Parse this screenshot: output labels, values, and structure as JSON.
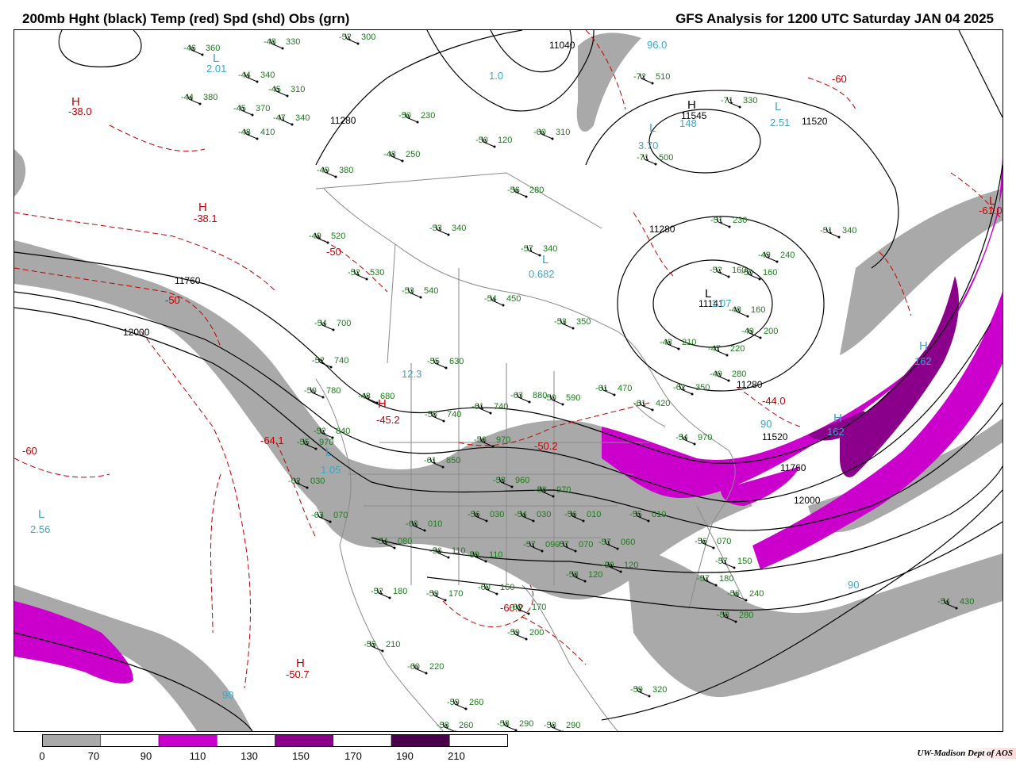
{
  "header": {
    "left_title": "200mb Hght (black) Temp (red) Spd (shd) Obs (grn)",
    "right_title": "GFS Analysis for 1200 UTC Saturday  JAN 04 2025"
  },
  "colors": {
    "height_contour": "#000000",
    "temperature_contour": "#c00000",
    "observations": "#1a7a1a",
    "speed_labels": "#3aa6c8",
    "map_lines": "#8a8a8a",
    "shade_70_90": "#a9a9a9",
    "shade_110_130": "#cc00cc",
    "shade_150_170": "#8b008b",
    "shade_190_210": "#4b004b"
  },
  "map": {
    "height_labels": [
      "11760",
      "12000",
      "11280",
      "11520",
      "11280",
      "11141",
      "11545",
      "11520",
      "11760",
      "12000",
      "11280",
      "11040"
    ],
    "pressure_centers": {
      "highs": [
        "H",
        "H",
        "H",
        "H",
        "H",
        "H",
        "H"
      ],
      "lows": [
        "L",
        "L",
        "L",
        "L",
        "L",
        "L",
        "L",
        "L"
      ]
    },
    "temperature_values": [
      "-38.0",
      "-38.1",
      "-45.2",
      "-64.1",
      "-60",
      "-50.7",
      "-60.2",
      "-50.2",
      "-44.0",
      "-61.0",
      "-60",
      "-50",
      "-50"
    ],
    "speed_values": [
      "2.01",
      "2.56",
      "96.0",
      "1.0",
      "3.70",
      "0.682",
      "12.3",
      "1.05",
      "1.07",
      "2.51",
      "90",
      "162",
      "162",
      "90",
      "90",
      "148"
    ],
    "observations": [
      "-46 360",
      "-48 330",
      "-52 300",
      "-44 340",
      "-45 310",
      "-44 380",
      "-45 370",
      "-47 340",
      "-48 410",
      "-49 380",
      "-50 230",
      "-48 250",
      "-50 120",
      "-53 340",
      "-56 280",
      "-49 520",
      "-52 530",
      "-53 540",
      "-57 340",
      "-54 450",
      "-53 350",
      "-55 630",
      "-48 680",
      "-58 740",
      "-61 740",
      "-61 850",
      "-63 880",
      "-50 590",
      "-61 470",
      "-61 420",
      "-62 350",
      "-54 700",
      "-52 740",
      "-50 780",
      "-52 840",
      "-55 970",
      "-62 030",
      "-63 070",
      "-54 080",
      "-56 110",
      "-59 110",
      "-57 090",
      "-57 070",
      "-57 060",
      "-59 120",
      "-58 120",
      "-56 070",
      "-57 150",
      "-57 180",
      "-56 240",
      "-58 280",
      "-54 430",
      "-52 180",
      "-59 170",
      "-60 160",
      "-60 170",
      "-59 200",
      "-55 210",
      "-60 220",
      "-59 260",
      "-58 260",
      "-58 290",
      "-58 290",
      "-59 320",
      "-68 010",
      "-56 030",
      "-54 030",
      "-56 010",
      "-55 010",
      "-58 970",
      "-58 960",
      "-56 970",
      "-51 230",
      "-51 340",
      "-49 240",
      "-52 160",
      "-48 160",
      "-49 200",
      "-48 210",
      "-47 220",
      "-49 280",
      "-50 160",
      "-72 510",
      "-71 500",
      "-71 330",
      "-60 310",
      "-54 970"
    ]
  },
  "legend": {
    "ticks": [
      "0",
      "70",
      "90",
      "110",
      "130",
      "150",
      "170",
      "190",
      "210"
    ],
    "colors": [
      "#ffffff",
      "#a9a9a9",
      "#ffffff",
      "#cc00cc",
      "#ffffff",
      "#8b008b",
      "#ffffff",
      "#4b004b",
      "#ffffff"
    ]
  },
  "footer": {
    "credit": "UW-Madison  Dept of AOS"
  }
}
